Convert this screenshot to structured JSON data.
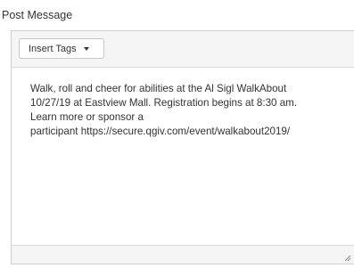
{
  "form": {
    "label": "Post Message"
  },
  "toolbar": {
    "insert_tags_label": "Insert Tags"
  },
  "editor": {
    "content": "Walk, roll and cheer for abilities at the Al Sigl WalkAbout\n10/27/19 at Eastview Mall.  Registration begins at 8:30 am.\nLearn more or sponsor a\nparticipant https://secure.qgiv.com/event/walkabout2019/"
  },
  "icons": {
    "dropdown": "chevron-down-icon",
    "resize": "resize-grip-icon"
  }
}
